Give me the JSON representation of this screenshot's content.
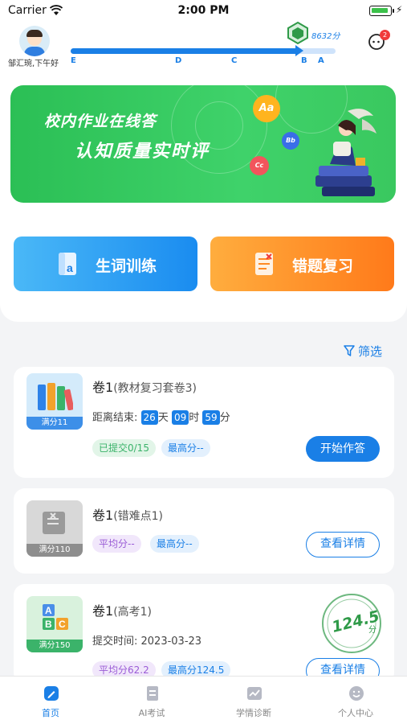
{
  "status": {
    "carrier": "Carrier",
    "time": "2:00 PM"
  },
  "header": {
    "greeting": "邹汇琬,下午好",
    "score": "8632分",
    "unread_count": "2",
    "progress": 0.86,
    "levels": [
      "E",
      "D",
      "C",
      "B",
      "A"
    ]
  },
  "banner": {
    "line1": "校内作业在线答",
    "line2": "认知质量实时评",
    "bubbles": [
      "Aa",
      "Bb",
      "Cc"
    ]
  },
  "actions": {
    "vocab_label": "生词训练",
    "review_label": "错题复习"
  },
  "filter_label": "筛选",
  "cards": [
    {
      "title": "卷1",
      "subtitle": "(教材复习套卷3)",
      "full_score": "满分11",
      "countdown_label": "距离结束:",
      "days": "26",
      "days_unit": "天",
      "hours": "09",
      "hours_unit": "时",
      "minutes": "59",
      "minutes_unit": "分",
      "tag1": "已提交0/15",
      "tag2": "最高分--",
      "button": "开始作答"
    },
    {
      "title": "卷1",
      "subtitle": "(错难点1)",
      "full_score": "满分110",
      "tag1": "平均分--",
      "tag2": "最高分--",
      "button": "查看详情"
    },
    {
      "title": "卷1",
      "subtitle": "(高考1)",
      "full_score": "满分150",
      "submit_time": "提交时间: 2023-03-23",
      "tag1": "平均分62.2",
      "tag2": "最高分124.5",
      "stamp_score": "124.5",
      "stamp_unit": "分",
      "button": "查看详情"
    }
  ],
  "tabs": [
    {
      "label": "首页",
      "active": true
    },
    {
      "label": "AI考试",
      "active": false
    },
    {
      "label": "学情诊断",
      "active": false
    },
    {
      "label": "个人中心",
      "active": false
    }
  ],
  "colors": {
    "primary": "#1a7fe6",
    "banner": "#34c760",
    "review": "#ff8a24",
    "tag_green": "#3bb36a",
    "tag_purple": "#9a5bd6",
    "stamp": "#2f9a48"
  }
}
